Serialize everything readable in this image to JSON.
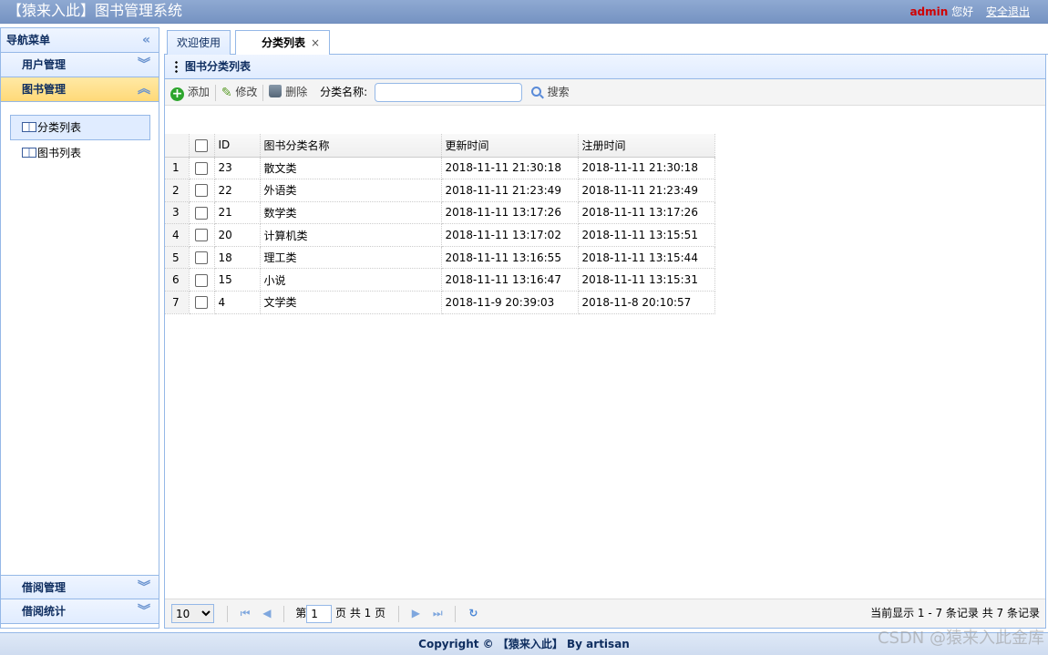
{
  "header": {
    "title": "【猿来入此】图书管理系统",
    "username": "admin",
    "greeting": "您好",
    "logout_label": "安全退出"
  },
  "nav": {
    "title": "导航菜单",
    "sections": [
      {
        "label": "用户管理"
      },
      {
        "label": "图书管理"
      },
      {
        "label": "借阅管理"
      },
      {
        "label": "借阅统计"
      }
    ],
    "items": [
      {
        "label": "分类列表",
        "icon": "book-icon"
      },
      {
        "label": "图书列表",
        "icon": "book-icon"
      }
    ]
  },
  "tabs": [
    {
      "label": "欢迎使用"
    },
    {
      "label": "分类列表",
      "close": "×"
    }
  ],
  "panel": {
    "title": "图书分类列表"
  },
  "toolbar": {
    "add_label": "添加",
    "edit_label": "修改",
    "delete_label": "删除",
    "search_label": "分类名称:",
    "search_value": "",
    "search_button": "搜索"
  },
  "grid": {
    "headers": {
      "id": "ID",
      "name": "图书分类名称",
      "updated": "更新时间",
      "registered": "注册时间"
    },
    "rows": [
      {
        "rn": "1",
        "id": "23",
        "name": "散文类",
        "updated": "2018-11-11 21:30:18",
        "registered": "2018-11-11 21:30:18"
      },
      {
        "rn": "2",
        "id": "22",
        "name": "外语类",
        "updated": "2018-11-11 21:23:49",
        "registered": "2018-11-11 21:23:49"
      },
      {
        "rn": "3",
        "id": "21",
        "name": "数学类",
        "updated": "2018-11-11 13:17:26",
        "registered": "2018-11-11 13:17:26"
      },
      {
        "rn": "4",
        "id": "20",
        "name": "计算机类",
        "updated": "2018-11-11 13:17:02",
        "registered": "2018-11-11 13:15:51"
      },
      {
        "rn": "5",
        "id": "18",
        "name": "理工类",
        "updated": "2018-11-11 13:16:55",
        "registered": "2018-11-11 13:15:44"
      },
      {
        "rn": "6",
        "id": "15",
        "name": "小说",
        "updated": "2018-11-11 13:16:47",
        "registered": "2018-11-11 13:15:31"
      },
      {
        "rn": "7",
        "id": "4",
        "name": "文学类",
        "updated": "2018-11-9 20:39:03",
        "registered": "2018-11-8 20:10:57"
      }
    ]
  },
  "pager": {
    "page_size": "10",
    "page_prefix": "第",
    "page_value": "1",
    "page_suffix": "页 共 1 页",
    "info": "当前显示 1 - 7 条记录 共 7 条记录"
  },
  "footer": {
    "text": "Copyright © 【猿来入此】 By artisan"
  },
  "watermark": "CSDN @猿来入此金库"
}
